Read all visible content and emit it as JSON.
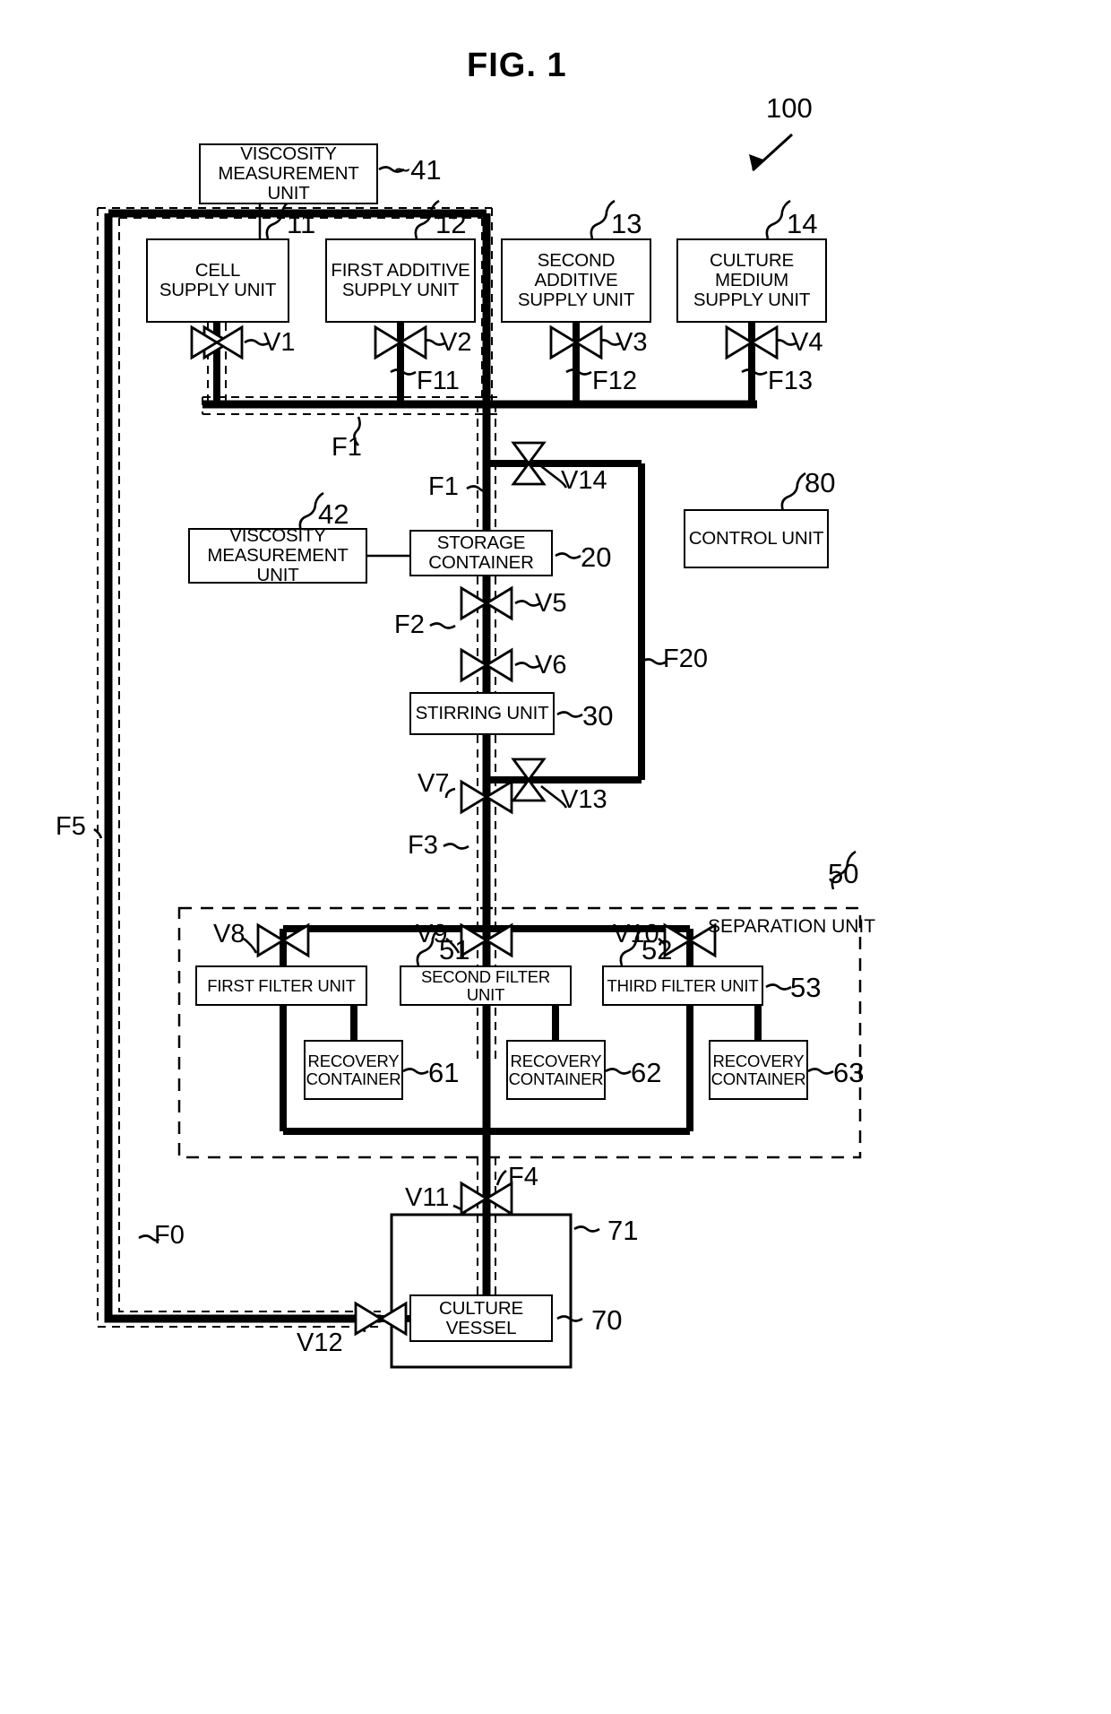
{
  "figure": {
    "title": "FIG. 1",
    "system_ref": "100"
  },
  "boxes": [
    {
      "id": "vmu41",
      "label": "VISCOSITY\nMEASUREMENT UNIT",
      "ref": "41",
      "name": "viscosity-measurement-unit-41"
    },
    {
      "id": "cell11",
      "label": "CELL\nSUPPLY UNIT",
      "ref": "11",
      "name": "cell-supply-unit"
    },
    {
      "id": "add12",
      "label": "FIRST ADDITIVE\nSUPPLY UNIT",
      "ref": "12",
      "name": "first-additive-supply-unit"
    },
    {
      "id": "add13",
      "label": "SECOND ADDITIVE\nSUPPLY UNIT",
      "ref": "13",
      "name": "second-additive-supply-unit"
    },
    {
      "id": "med14",
      "label": "CULTURE MEDIUM\nSUPPLY UNIT",
      "ref": "14",
      "name": "culture-medium-supply-unit"
    },
    {
      "id": "vmu42",
      "label": "VISCOSITY\nMEASUREMENT UNIT",
      "ref": "42",
      "name": "viscosity-measurement-unit-42"
    },
    {
      "id": "store20",
      "label": "STORAGE\nCONTAINER",
      "ref": "20",
      "name": "storage-container"
    },
    {
      "id": "ctrl80",
      "label": "CONTROL UNIT",
      "ref": "80",
      "name": "control-unit"
    },
    {
      "id": "stir30",
      "label": "STIRRING UNIT",
      "ref": "30",
      "name": "stirring-unit"
    },
    {
      "id": "filt51",
      "label": "FIRST FILTER UNIT",
      "ref": "51",
      "name": "first-filter-unit"
    },
    {
      "id": "filt52",
      "label": "SECOND FILTER UNIT",
      "ref": "52",
      "name": "second-filter-unit"
    },
    {
      "id": "filt53",
      "label": "THIRD FILTER UNIT",
      "ref": "53",
      "name": "third-filter-unit"
    },
    {
      "id": "rec61",
      "label": "RECOVERY\nCONTAINER",
      "ref": "61",
      "name": "recovery-container-61"
    },
    {
      "id": "rec62",
      "label": "RECOVERY\nCONTAINER",
      "ref": "62",
      "name": "recovery-container-62"
    },
    {
      "id": "rec63",
      "label": "RECOVERY\nCONTAINER",
      "ref": "63",
      "name": "recovery-container-63"
    },
    {
      "id": "vessel70",
      "label": "CULTURE VESSEL",
      "ref": "70",
      "name": "culture-vessel"
    },
    {
      "id": "jacket71",
      "label": "",
      "ref": "71",
      "name": "culture-vessel-jacket"
    }
  ],
  "separation_unit": {
    "title": "SEPARATION UNIT",
    "ref": "50",
    "name": "separation-unit"
  },
  "valves": [
    {
      "id": "V1",
      "label": "V1",
      "orient": "h"
    },
    {
      "id": "V2",
      "label": "V2",
      "orient": "h"
    },
    {
      "id": "V3",
      "label": "V3",
      "orient": "h"
    },
    {
      "id": "V4",
      "label": "V4",
      "orient": "h"
    },
    {
      "id": "V5",
      "label": "V5",
      "orient": "h"
    },
    {
      "id": "V6",
      "label": "V6",
      "orient": "h"
    },
    {
      "id": "V7",
      "label": "V7",
      "orient": "h"
    },
    {
      "id": "V8",
      "label": "V8",
      "orient": "h"
    },
    {
      "id": "V9",
      "label": "V9",
      "orient": "h"
    },
    {
      "id": "V10",
      "label": "V10",
      "orient": "h"
    },
    {
      "id": "V11",
      "label": "V11",
      "orient": "h"
    },
    {
      "id": "V12",
      "label": "V12",
      "orient": "h"
    },
    {
      "id": "V13",
      "label": "V13",
      "orient": "v"
    },
    {
      "id": "V14",
      "label": "V14",
      "orient": "v"
    }
  ],
  "flow_lines": [
    {
      "id": "F0",
      "label": "F0"
    },
    {
      "id": "F1a",
      "label": "F1"
    },
    {
      "id": "F1b",
      "label": "F1"
    },
    {
      "id": "F1c",
      "label": "F1"
    },
    {
      "id": "F2",
      "label": "F2"
    },
    {
      "id": "F3",
      "label": "F3"
    },
    {
      "id": "F4",
      "label": "F4"
    },
    {
      "id": "F5",
      "label": "F5"
    },
    {
      "id": "F11",
      "label": "F11"
    },
    {
      "id": "F12",
      "label": "F12"
    },
    {
      "id": "F13",
      "label": "F13"
    },
    {
      "id": "F20",
      "label": "F20"
    }
  ],
  "colors": {
    "line": "#000000",
    "background": "#ffffff"
  }
}
